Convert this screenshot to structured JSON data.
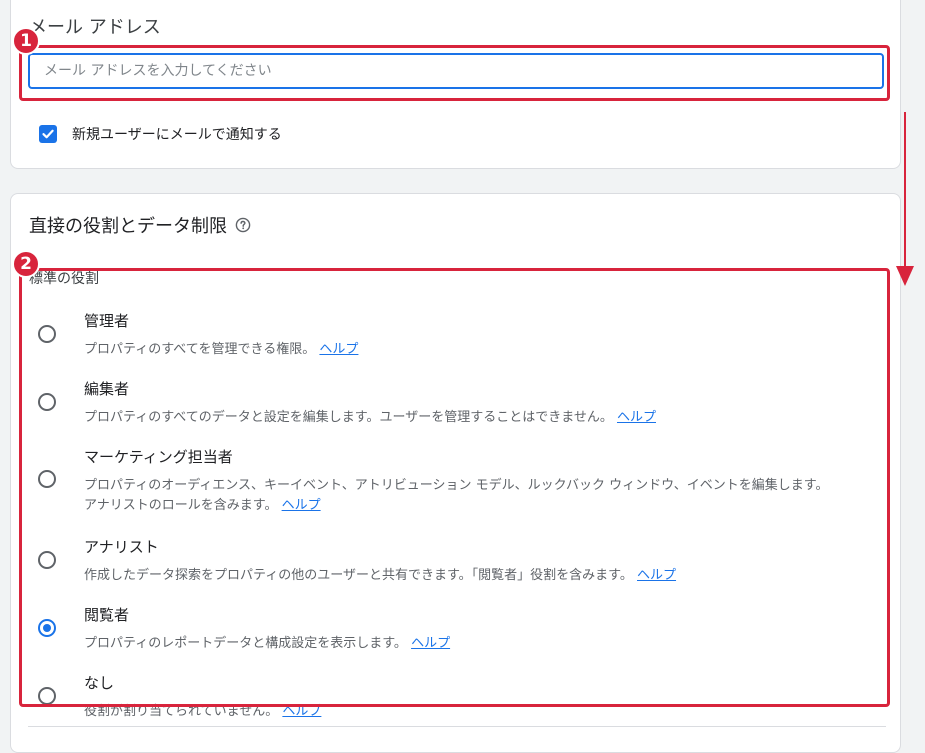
{
  "email_section": {
    "title": "メール アドレス",
    "input_placeholder": "メール アドレスを入力してください",
    "notify_label": "新規ユーザーにメールで通知する",
    "notify_checked": true
  },
  "roles_section": {
    "title": "直接の役割とデータ制限",
    "subsection_label": "標準の役割",
    "roles": [
      {
        "name": "管理者",
        "description": "プロパティのすべてを管理できる権限。",
        "help": "ヘルプ",
        "selected": false
      },
      {
        "name": "編集者",
        "description": "プロパティのすべてのデータと設定を編集します。ユーザーを管理することはできません。",
        "help": "ヘルプ",
        "selected": false
      },
      {
        "name": "マーケティング担当者",
        "description_line1": "プロパティのオーディエンス、キーイベント、アトリビューション モデル、ルックバック ウィンドウ、イベントを編集します。",
        "description": "アナリストのロールを含みます。",
        "help": "ヘルプ",
        "selected": false
      },
      {
        "name": "アナリスト",
        "description": "作成したデータ探索をプロパティの他のユーザーと共有できます。「閲覧者」役割を含みます。",
        "help": "ヘルプ",
        "selected": false
      },
      {
        "name": "閲覧者",
        "description": "プロパティのレポートデータと構成設定を表示します。",
        "help": "ヘルプ",
        "selected": true
      },
      {
        "name": "なし",
        "description": "役割が割り当てられていません。",
        "help": "ヘルプ",
        "selected": false
      }
    ]
  },
  "annotations": {
    "badge1": "1",
    "badge2": "2",
    "color": "#d8243c"
  },
  "colors": {
    "accent": "#1a73e8",
    "annotation_red": "#d8243c"
  }
}
